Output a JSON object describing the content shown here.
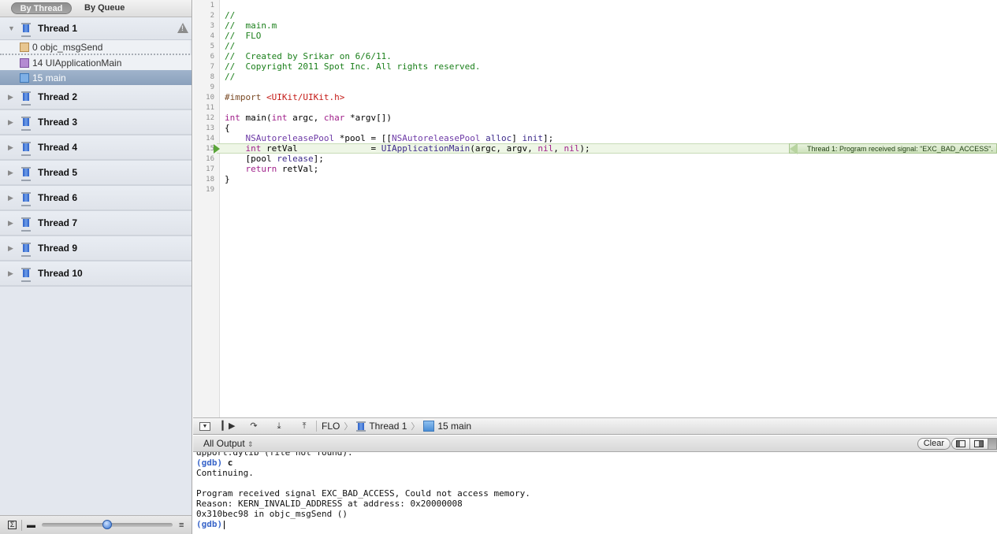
{
  "sidebar": {
    "segments": [
      {
        "label": "By Thread",
        "active": true
      },
      {
        "label": "By Queue",
        "active": false
      }
    ],
    "threads": [
      {
        "label": "Thread 1",
        "expanded": true,
        "warning": true,
        "frames": [
          {
            "label": "0 objc_msgSend",
            "icon": "gear-icon"
          },
          {
            "label": "14 UIApplicationMain",
            "icon": "cup-icon"
          },
          {
            "label": "15 main",
            "icon": "user-icon",
            "selected": true
          }
        ]
      },
      {
        "label": "Thread 2"
      },
      {
        "label": "Thread 3"
      },
      {
        "label": "Thread 4"
      },
      {
        "label": "Thread 5"
      },
      {
        "label": "Thread 6"
      },
      {
        "label": "Thread 7"
      },
      {
        "label": "Thread 9"
      },
      {
        "label": "Thread 10"
      }
    ],
    "footer": {
      "slider_value": 0.5
    }
  },
  "editor": {
    "line_numbers": [
      "1",
      "2",
      "3",
      "4",
      "5",
      "6",
      "7",
      "8",
      "9",
      "10",
      "11",
      "12",
      "13",
      "14",
      "15",
      "16",
      "17",
      "18",
      "19"
    ],
    "lines": {
      "l2": "//",
      "l3": "//  main.m",
      "l4": "//  FLO",
      "l5": "//",
      "l6": "//  Created by Srikar on 6/6/11.",
      "l7": "//  Copyright 2011 Spot Inc. All rights reserved.",
      "l8": "//",
      "l10_a": "#import ",
      "l10_b": "<UIKit/UIKit.h>",
      "l12_a": "int",
      "l12_b": " main(",
      "l12_c": "int",
      "l12_d": " argc, ",
      "l12_e": "char",
      "l12_f": " *argv[])",
      "l13": "{",
      "l14_a": "    ",
      "l14_b": "NSAutoreleasePool",
      "l14_c": " *pool = [[",
      "l14_d": "NSAutoreleasePool",
      "l14_e": " ",
      "l14_f": "alloc",
      "l14_g": "] ",
      "l14_h": "init",
      "l14_i": "];",
      "l15_a": "    ",
      "l15_b": "int",
      "l15_c": " retVal              = ",
      "l15_d": "UIApplicationMain",
      "l15_e": "(argc, argv, ",
      "l15_f": "nil",
      "l15_g": ", ",
      "l15_h": "nil",
      "l15_i": ");",
      "l16_a": "    [pool ",
      "l16_b": "release",
      "l16_c": "];",
      "l17_a": "    ",
      "l17_b": "return",
      "l17_c": " retVal;",
      "l18": "}"
    },
    "current_line": "15",
    "signal_message": "Thread 1: Program received signal:  \"EXC_BAD_ACCESS\"."
  },
  "debugbar": {
    "breadcrumb": [
      {
        "label": "FLO"
      },
      {
        "label": "Thread 1"
      },
      {
        "label": "15 main"
      }
    ]
  },
  "console": {
    "output_select": "All Output",
    "clear_label": "Clear",
    "lines": {
      "clipped": "dpport.dylib (file not found).",
      "p1": "(gdb)",
      "c1": " c",
      "l2": "Continuing.",
      "l3": "",
      "l4": "Program received signal EXC_BAD_ACCESS, Could not access memory.",
      "l5": "Reason: KERN_INVALID_ADDRESS at address: 0x20000008",
      "l6": "0x310bec98 in objc_msgSend ()",
      "p2": "(gdb)"
    }
  }
}
